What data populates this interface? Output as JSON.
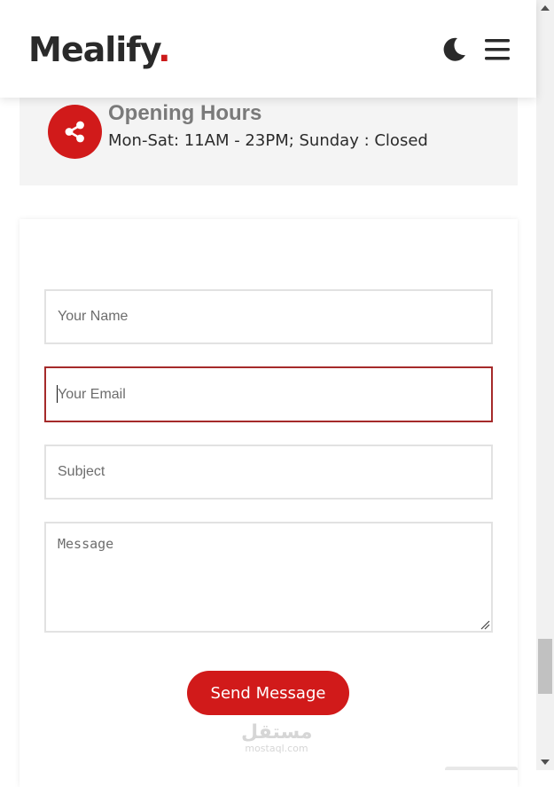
{
  "header": {
    "logo_text": "Mealify",
    "logo_dot": ".",
    "theme_toggle_icon": "moon-icon",
    "menu_icon": "hamburger-menu-icon"
  },
  "info": {
    "icon": "share-icon",
    "title": "Opening Hours",
    "text": "Mon-Sat: 11AM - 23PM; Sunday : Closed"
  },
  "form": {
    "name_placeholder": "Your Name",
    "email_placeholder": "Your Email",
    "subject_placeholder": "Subject",
    "message_placeholder": "Message",
    "submit_label": "Send Message"
  },
  "watermark": {
    "main": "مستقل",
    "sub": "mostaql.com"
  },
  "colors": {
    "accent": "#d11a1a",
    "focus_border": "#a52a2a",
    "logo_text": "#2a2a2a",
    "info_bg": "#f4f4f4"
  }
}
